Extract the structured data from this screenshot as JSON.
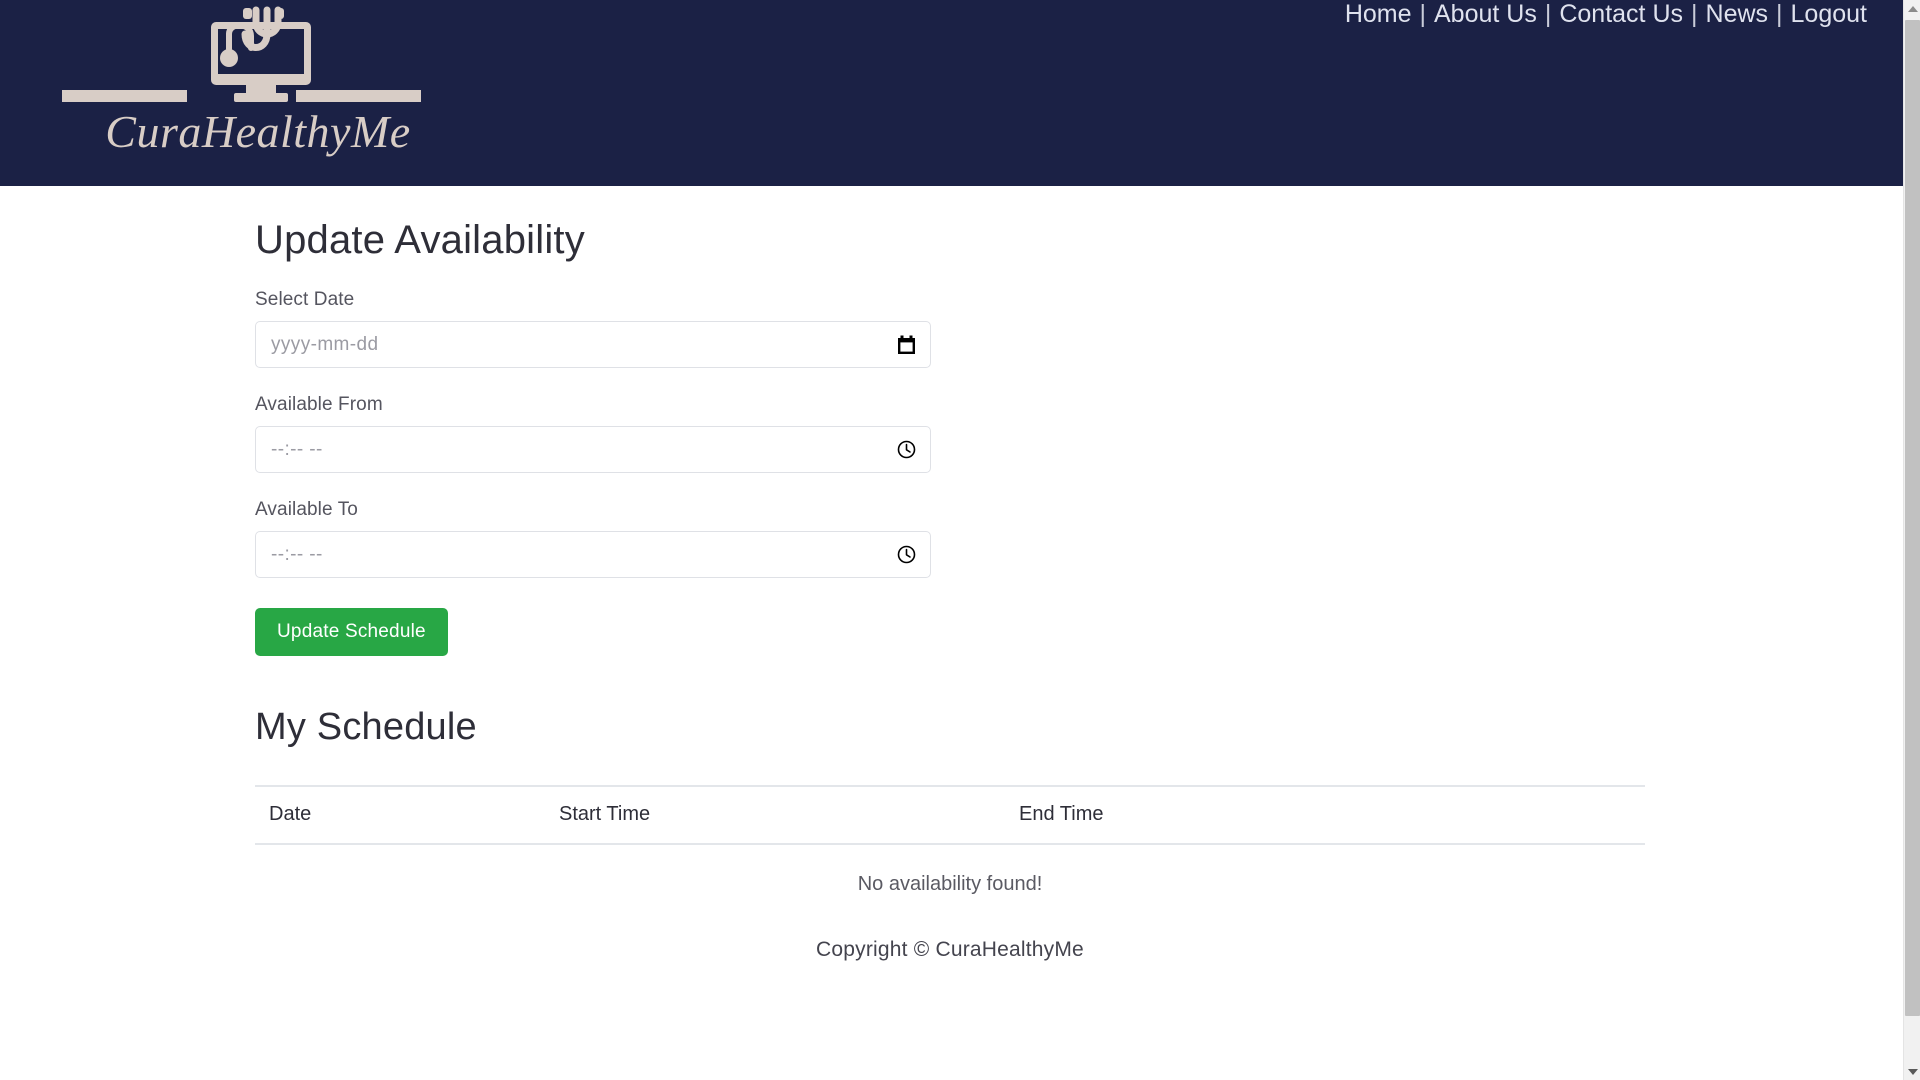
{
  "brand": {
    "name": "CuraHealthyMe",
    "logo_icon": "monitor-stethoscope-icon",
    "navy": "#1b2145",
    "logo_beige": "#d8cdc6"
  },
  "nav": {
    "items": [
      {
        "label": "Home"
      },
      {
        "label": "About Us"
      },
      {
        "label": "Contact Us"
      },
      {
        "label": "News"
      },
      {
        "label": "Logout"
      }
    ],
    "separator": "|"
  },
  "main": {
    "page_title": "Update Availability",
    "fields": [
      {
        "label": "Select Date",
        "value": "",
        "placeholder": "yyyy-mm-dd",
        "icon": "calendar-icon",
        "type": "date"
      },
      {
        "label": "Available From",
        "value": "",
        "placeholder": "--:-- --",
        "icon": "clock-icon",
        "type": "time"
      },
      {
        "label": "Available To",
        "value": "",
        "placeholder": "--:-- --",
        "icon": "clock-icon",
        "type": "time"
      }
    ],
    "submit_label": "Update Schedule",
    "submit_color": "#28a745"
  },
  "schedule": {
    "section_title": "My Schedule",
    "columns": [
      "Date",
      "Start Time",
      "End Time"
    ],
    "rows": [],
    "empty_message": "No availability found!"
  },
  "footer": {
    "copyright": "Copyright © CuraHealthyMe"
  },
  "scrollbar": {
    "up_arrow": "scroll-up-arrow-icon",
    "down_arrow": "scroll-down-arrow-icon"
  }
}
